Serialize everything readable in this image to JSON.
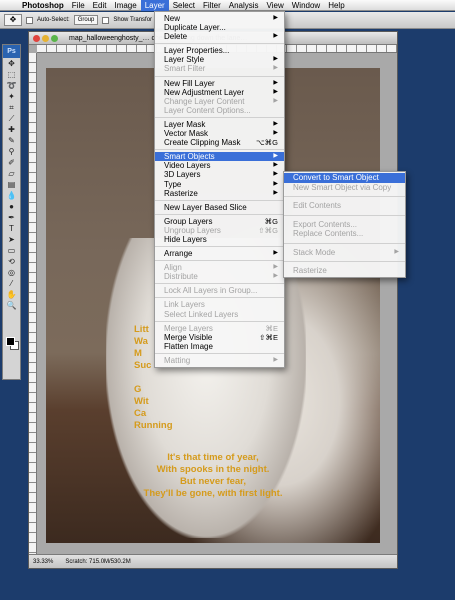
{
  "menubar": {
    "apple": "",
    "items": [
      "Photoshop",
      "File",
      "Edit",
      "Image",
      "Layer",
      "Select",
      "Filter",
      "Analysis",
      "View",
      "Window",
      "Help"
    ],
    "active_index": 4
  },
  "options_bar": {
    "auto_select_label": "Auto-Select:",
    "auto_select_value": "Group",
    "show_transform_label": "Show Transfor"
  },
  "tools": {
    "logo": "Ps",
    "icons": [
      "move-tool",
      "marquee-tool",
      "lasso-tool",
      "magic-wand-tool",
      "crop-tool",
      "slice-tool",
      "healing-brush-tool",
      "brush-tool",
      "clone-stamp-tool",
      "history-brush-tool",
      "eraser-tool",
      "gradient-tool",
      "blur-tool",
      "dodge-tool",
      "pen-tool",
      "type-tool",
      "path-selection-tool",
      "shape-tool",
      "3d-rotate-tool",
      "3d-orbit-tool",
      "eyedropper-tool",
      "hand-tool",
      "zoom-tool"
    ]
  },
  "document": {
    "title": "map_halloweenghosty_… ches, Walking down the lane…",
    "poem_top": [
      "Litt",
      "Wa",
      "M",
      "Suc",
      "",
      "G",
      "Wit",
      "Ca",
      "Running"
    ],
    "poem_bottom": [
      "It's that time of year,",
      "With spooks in the night.",
      "But never fear,",
      "They'll be gone, with first light."
    ],
    "zoom": "33.33%",
    "scratch": "Scratch: 715.0M/530.2M"
  },
  "layer_menu": {
    "groups": [
      [
        {
          "label": "New",
          "arrow": true
        },
        {
          "label": "Duplicate Layer..."
        },
        {
          "label": "Delete",
          "arrow": true
        }
      ],
      [
        {
          "label": "Layer Properties..."
        },
        {
          "label": "Layer Style",
          "arrow": true
        },
        {
          "label": "Smart Filter",
          "arrow": true,
          "disabled": true
        }
      ],
      [
        {
          "label": "New Fill Layer",
          "arrow": true
        },
        {
          "label": "New Adjustment Layer",
          "arrow": true
        },
        {
          "label": "Change Layer Content",
          "arrow": true,
          "disabled": true
        },
        {
          "label": "Layer Content Options...",
          "disabled": true
        }
      ],
      [
        {
          "label": "Layer Mask",
          "arrow": true
        },
        {
          "label": "Vector Mask",
          "arrow": true
        },
        {
          "label": "Create Clipping Mask",
          "shortcut": "⌥⌘G"
        }
      ],
      [
        {
          "label": "Smart Objects",
          "arrow": true,
          "highlighted": true
        },
        {
          "label": "Video Layers",
          "arrow": true
        },
        {
          "label": "3D Layers",
          "arrow": true
        },
        {
          "label": "Type",
          "arrow": true
        },
        {
          "label": "Rasterize",
          "arrow": true
        }
      ],
      [
        {
          "label": "New Layer Based Slice"
        }
      ],
      [
        {
          "label": "Group Layers",
          "shortcut": "⌘G"
        },
        {
          "label": "Ungroup Layers",
          "shortcut": "⇧⌘G",
          "disabled": true
        },
        {
          "label": "Hide Layers"
        }
      ],
      [
        {
          "label": "Arrange",
          "arrow": true
        }
      ],
      [
        {
          "label": "Align",
          "arrow": true,
          "disabled": true
        },
        {
          "label": "Distribute",
          "arrow": true,
          "disabled": true
        }
      ],
      [
        {
          "label": "Lock All Layers in Group...",
          "disabled": true
        }
      ],
      [
        {
          "label": "Link Layers",
          "disabled": true
        },
        {
          "label": "Select Linked Layers",
          "disabled": true
        }
      ],
      [
        {
          "label": "Merge Layers",
          "shortcut": "⌘E",
          "disabled": true
        },
        {
          "label": "Merge Visible",
          "shortcut": "⇧⌘E"
        },
        {
          "label": "Flatten Image"
        }
      ],
      [
        {
          "label": "Matting",
          "arrow": true,
          "disabled": true
        }
      ]
    ]
  },
  "smart_objects_menu": {
    "groups": [
      [
        {
          "label": "Convert to Smart Object",
          "highlighted": true
        },
        {
          "label": "New Smart Object via Copy",
          "disabled": true
        }
      ],
      [
        {
          "label": "Edit Contents",
          "disabled": true
        }
      ],
      [
        {
          "label": "Export Contents...",
          "disabled": true
        },
        {
          "label": "Replace Contents...",
          "disabled": true
        }
      ],
      [
        {
          "label": "Stack Mode",
          "arrow": true,
          "disabled": true
        }
      ],
      [
        {
          "label": "Rasterize",
          "disabled": true
        }
      ]
    ]
  },
  "colors": {
    "menu_highlight": "#3a6fd8",
    "poem_text": "#d59b1c",
    "desktop": "#1c3c6c"
  }
}
